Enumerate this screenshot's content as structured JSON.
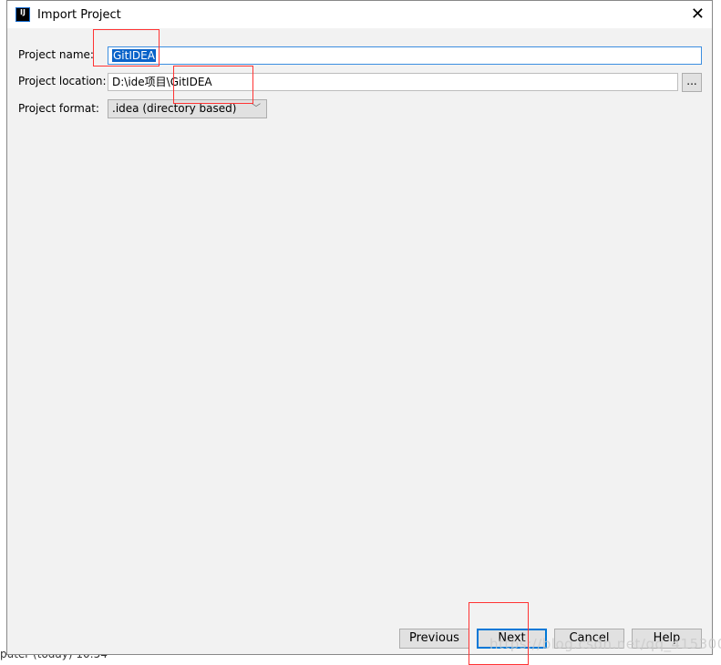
{
  "window": {
    "title": "Import Project",
    "logo": "IJ"
  },
  "form": {
    "name_label": "Project name:",
    "name_value": "GitIDEA",
    "location_label": "Project location:",
    "location_value": "D:\\ide项目\\GitIDEA",
    "browse_label": "...",
    "format_label": "Project format:",
    "format_value": ".idea (directory based)"
  },
  "buttons": {
    "previous": "Previous",
    "next": "Next",
    "cancel": "Cancel",
    "help": "Help"
  },
  "watermark": "https://blog.csdn.net/qq_41530004",
  "background_text": "puter (today) 10:54"
}
